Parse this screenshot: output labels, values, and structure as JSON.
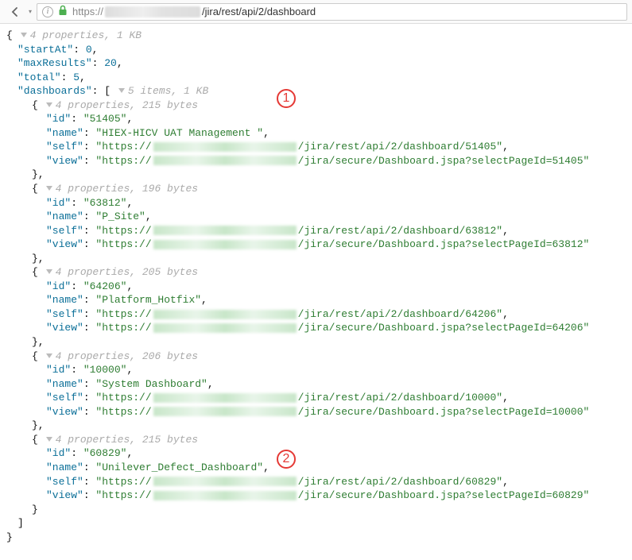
{
  "browser": {
    "url_prefix": "https://",
    "url_suffix": "/jira/rest/api/2/dashboard"
  },
  "root_meta": "4 properties, 1 KB",
  "startAt_key": "\"startAt\"",
  "startAt_val": "0",
  "maxResults_key": "\"maxResults\"",
  "maxResults_val": "20",
  "total_key": "\"total\"",
  "total_val": "5",
  "dashboards_key": "\"dashboards\"",
  "dashboards_meta": "5 items, 1 KB",
  "item_meta": [
    "4 properties, 215 bytes",
    "4 properties, 196 bytes",
    "4 properties, 205 bytes",
    "4 properties, 206 bytes",
    "4 properties, 215 bytes"
  ],
  "keys": {
    "id": "\"id\"",
    "name": "\"name\"",
    "self": "\"self\"",
    "view": "\"view\""
  },
  "items": [
    {
      "id": "\"51405\"",
      "name": "\"HIEX-HICV UAT Management \"",
      "selfTail": "/jira/rest/api/2/dashboard/51405\"",
      "viewTail": "/jira/secure/Dashboard.jspa?selectPageId=51405\""
    },
    {
      "id": "\"63812\"",
      "name": "\"P_Site\"",
      "selfTail": "/jira/rest/api/2/dashboard/63812\"",
      "viewTail": "/jira/secure/Dashboard.jspa?selectPageId=63812\""
    },
    {
      "id": "\"64206\"",
      "name": "\"Platform_Hotfix\"",
      "selfTail": "/jira/rest/api/2/dashboard/64206\"",
      "viewTail": "/jira/secure/Dashboard.jspa?selectPageId=64206\""
    },
    {
      "id": "\"10000\"",
      "name": "\"System Dashboard\"",
      "selfTail": "/jira/rest/api/2/dashboard/10000\"",
      "viewTail": "/jira/secure/Dashboard.jspa?selectPageId=10000\""
    },
    {
      "id": "\"60829\"",
      "name": "\"Unilever_Defect_Dashboard\"",
      "selfTail": "/jira/rest/api/2/dashboard/60829\"",
      "viewTail": "/jira/secure/Dashboard.jspa?selectPageId=60829\""
    }
  ],
  "https_prefix": "\"https://",
  "annotations": [
    "1",
    "2"
  ]
}
